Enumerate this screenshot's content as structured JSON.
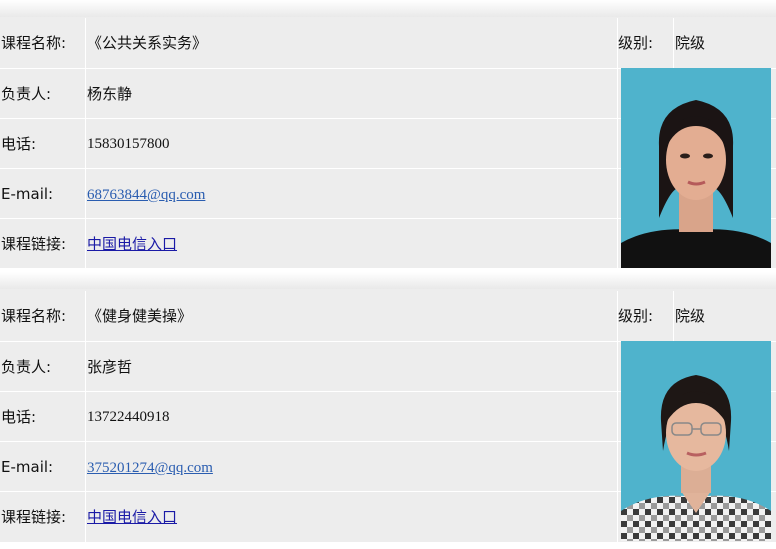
{
  "labels": {
    "course_name": "课程名称:",
    "owner": "负责人:",
    "phone": "电话:",
    "email": "E-mail:",
    "course_link": "课程链接:",
    "level": "级别:"
  },
  "courses": [
    {
      "name": "《公共关系实务》",
      "level": "院级",
      "owner": "杨东静",
      "phone": "15830157800",
      "email": "68763844@qq.com",
      "link_text": "中国电信入口"
    },
    {
      "name": "《健身健美操》",
      "level": "院级",
      "owner": "张彦哲",
      "phone": "13722440918",
      "email": "375201274@qq.com",
      "link_text": "中国电信入口"
    }
  ],
  "colors": {
    "panel": "#ededed",
    "photo_bg": "#4fb3cc",
    "link": "#1a1aa6"
  }
}
